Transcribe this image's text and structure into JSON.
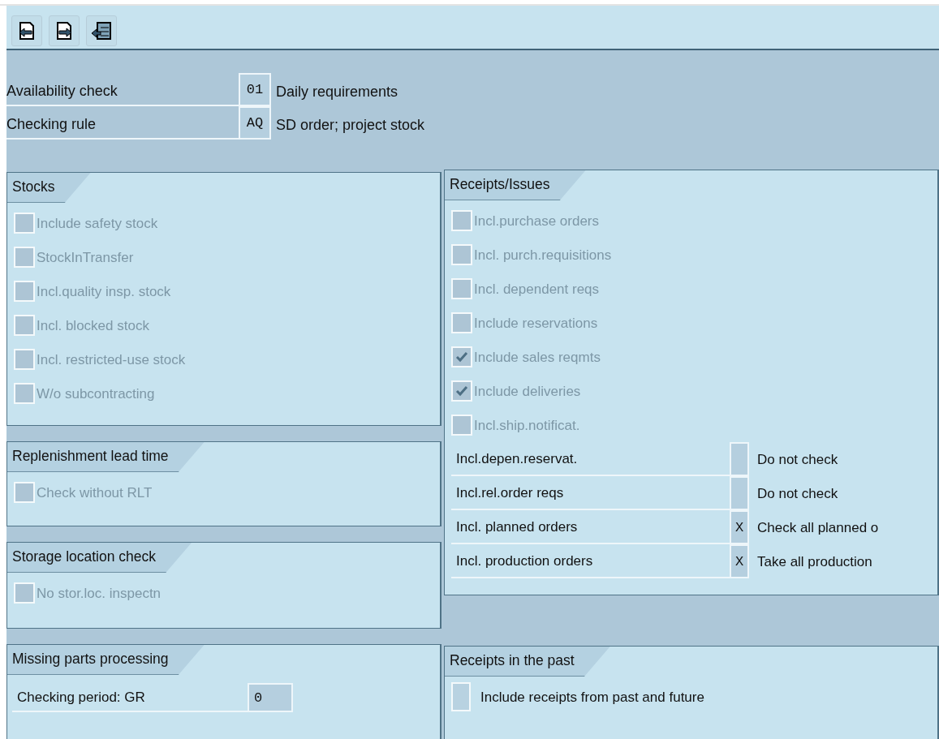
{
  "header": {
    "fields": [
      {
        "label": "Availability check",
        "value": "01",
        "description": "Daily requirements"
      },
      {
        "label": "Checking rule",
        "value": "AQ",
        "description": "SD order; project stock"
      }
    ]
  },
  "left_panels": [
    {
      "title": "Stocks",
      "items": [
        {
          "kind": "checkbox",
          "label": "Include safety stock",
          "checked": false,
          "disabled": true
        },
        {
          "kind": "checkbox",
          "label": "StockInTransfer",
          "checked": false,
          "disabled": true
        },
        {
          "kind": "checkbox",
          "label": "Incl.quality insp. stock",
          "checked": false,
          "disabled": true
        },
        {
          "kind": "checkbox",
          "label": "Incl. blocked stock",
          "checked": false,
          "disabled": true
        },
        {
          "kind": "checkbox",
          "label": "Incl. restricted-use stock",
          "checked": false,
          "disabled": true
        },
        {
          "kind": "checkbox",
          "label": "W/o subcontracting",
          "checked": false,
          "disabled": true
        }
      ]
    },
    {
      "title": "Replenishment lead time",
      "items": [
        {
          "kind": "checkbox",
          "label": "Check without RLT",
          "checked": false,
          "disabled": true
        }
      ]
    },
    {
      "title": "Storage location check",
      "items": [
        {
          "kind": "checkbox",
          "label": "No stor.loc. inspectn",
          "checked": false,
          "disabled": true
        }
      ]
    },
    {
      "title": "Missing parts processing",
      "items": [
        {
          "kind": "field",
          "label": "Checking period: GR",
          "value": "0"
        }
      ]
    }
  ],
  "right_panels": [
    {
      "title": "Receipts/Issues",
      "items": [
        {
          "kind": "checkbox",
          "label": "Incl.purchase orders",
          "checked": false,
          "disabled": true
        },
        {
          "kind": "checkbox",
          "label": "Incl. purch.requisitions",
          "checked": false,
          "disabled": true
        },
        {
          "kind": "checkbox",
          "label": "Incl. dependent reqs",
          "checked": false,
          "disabled": true
        },
        {
          "kind": "checkbox",
          "label": "Include reservations",
          "checked": false,
          "disabled": true
        },
        {
          "kind": "checkbox",
          "label": "Include sales reqmts",
          "checked": true,
          "disabled": true
        },
        {
          "kind": "checkbox",
          "label": "Include deliveries",
          "checked": true,
          "disabled": true
        },
        {
          "kind": "checkbox",
          "label": "Incl.ship.notificat.",
          "checked": false,
          "disabled": true
        },
        {
          "kind": "indicator",
          "label": "Incl.depen.reservat.",
          "description": "Do not check"
        },
        {
          "kind": "indicator",
          "label": "Incl.rel.order reqs",
          "description": "Do not check"
        },
        {
          "kind": "indicator",
          "label": "Incl. planned orders",
          "value": "X",
          "description": "Check all planned o"
        },
        {
          "kind": "indicator",
          "label": "Incl. production orders",
          "value": "X",
          "description": "Take all production"
        }
      ]
    },
    {
      "title": "Receipts in the past",
      "items": [
        {
          "kind": "checkbox",
          "label": "Include receipts from past and future",
          "checked": false,
          "disabled": false
        }
      ]
    }
  ]
}
